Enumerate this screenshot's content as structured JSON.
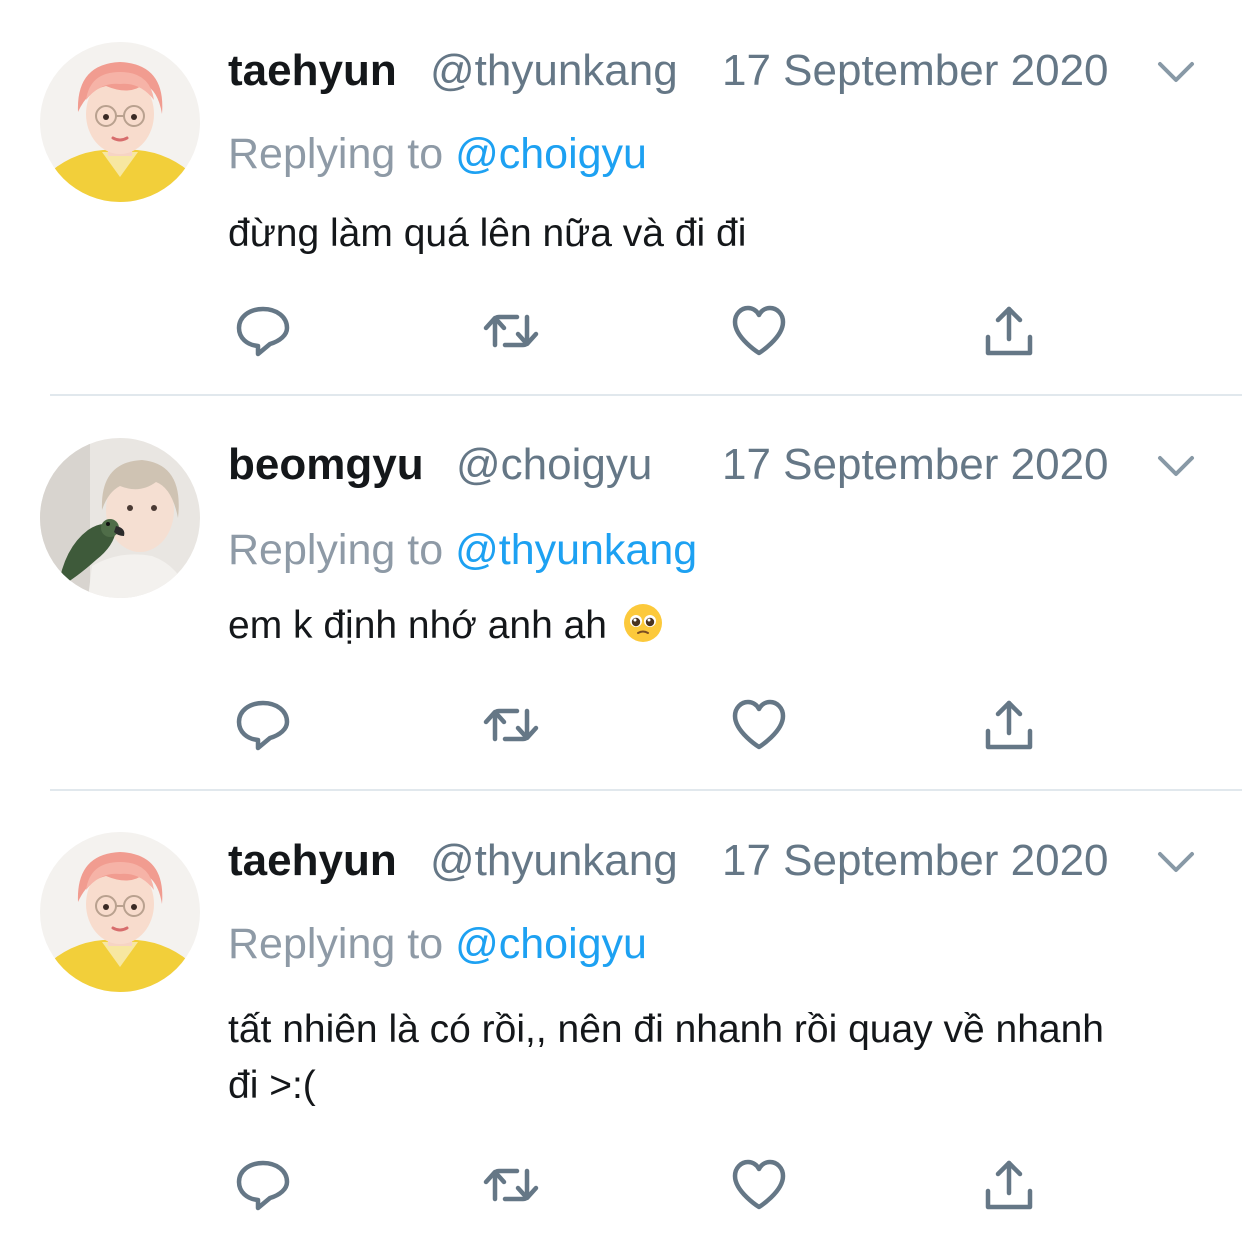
{
  "tweets": [
    {
      "name": "taehyun",
      "handle": "@thyunkang",
      "date": "17 September 2020",
      "replying_prefix": "Replying to",
      "replying_to": "@choigyu",
      "text": "đừng làm quá lên nữa và đi đi",
      "avatar": "avatar-pink-hair"
    },
    {
      "name": "beomgyu",
      "handle": "@choigyu",
      "date": "17 September 2020",
      "replying_prefix": "Replying to",
      "replying_to": "@thyunkang",
      "text": "em k định nhớ anh ah",
      "emoji": "pleading-face-emoji",
      "avatar": "avatar-with-parrot"
    },
    {
      "name": "taehyun",
      "handle": "@thyunkang",
      "date": "17 September 2020",
      "replying_prefix": "Replying to",
      "replying_to": "@choigyu",
      "text": "tất nhiên là có rồi,, nên đi nhanh rồi quay về nhanh đi >:(",
      "avatar": "avatar-pink-hair"
    }
  ],
  "icons": {
    "reply": "reply-icon",
    "retweet": "retweet-icon",
    "like": "heart-icon",
    "share": "share-icon",
    "menu": "chevron-down-icon"
  },
  "colors": {
    "mention": "#1da1f2",
    "secondary_text": "#657786",
    "icon": "#657786",
    "divider": "#e1e8ed"
  }
}
